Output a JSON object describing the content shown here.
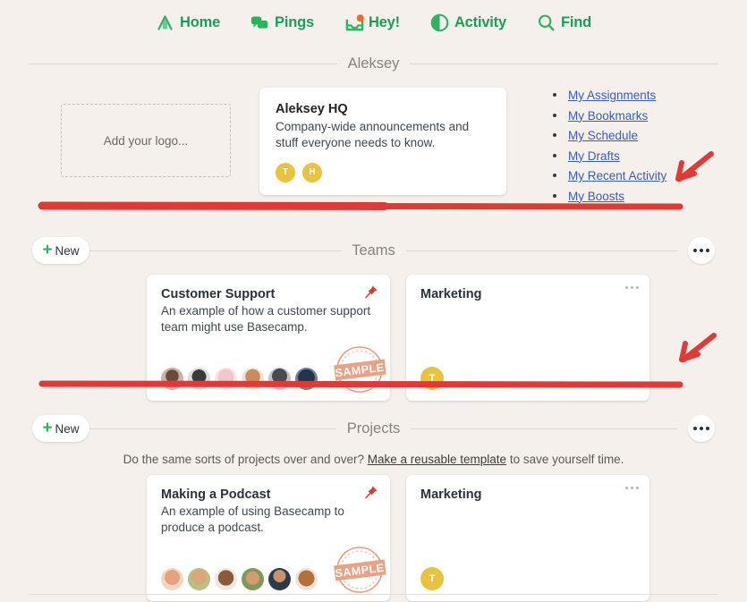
{
  "nav": {
    "items": [
      {
        "label": "Home",
        "icon": "home-icon"
      },
      {
        "label": "Pings",
        "icon": "chat-bubbles-icon"
      },
      {
        "label": "Hey!",
        "icon": "inbox-tray-icon",
        "badge": true
      },
      {
        "label": "Activity",
        "icon": "pie-clock-icon"
      },
      {
        "label": "Find",
        "icon": "search-icon"
      }
    ],
    "accent_color": "#1a9e57",
    "badge_color": "#f56a20"
  },
  "account": {
    "section_title": "Aleksey",
    "logo_placeholder": "Add your logo...",
    "hq": {
      "title": "Aleksey HQ",
      "description": "Company-wide announcements and stuff everyone needs to know.",
      "avatars": [
        {
          "initial": "T",
          "color": "#e8c33f"
        },
        {
          "initial": "H",
          "color": "#e2b93a"
        }
      ]
    },
    "my_links": [
      "My Assignments",
      "My Bookmarks",
      "My Schedule",
      "My Drafts",
      "My Recent Activity",
      "My Boosts"
    ]
  },
  "teams": {
    "section_title": "Teams",
    "new_label": "New",
    "menu_icon": "ellipsis-icon",
    "cards": [
      {
        "title": "Customer Support",
        "description": "An example of how a customer support team might use Basecamp.",
        "pinned": true,
        "stamp": "SAMPLE",
        "avatar_count": 6
      },
      {
        "title": "Marketing",
        "description": "",
        "pinned": false,
        "menu_icon": "ellipsis-icon",
        "avatars": [
          {
            "initial": "T",
            "color": "#e8c33f"
          }
        ]
      }
    ]
  },
  "projects": {
    "section_title": "Projects",
    "new_label": "New",
    "menu_icon": "ellipsis-icon",
    "template_prompt_before": "Do the same sorts of projects over and over? ",
    "template_link": "Make a reusable template",
    "template_prompt_after": " to save yourself time.",
    "cards": [
      {
        "title": "Making a Podcast",
        "description": "An example of using Basecamp to produce a podcast.",
        "pinned": true,
        "stamp": "SAMPLE",
        "avatar_count": 6
      },
      {
        "title": "Marketing",
        "description": "",
        "pinned": false,
        "menu_icon": "ellipsis-icon",
        "avatars": [
          {
            "initial": "T",
            "color": "#e8c33f"
          }
        ]
      }
    ]
  },
  "annotations": {
    "marker_color": "#e03a36",
    "items": [
      {
        "type": "arrow",
        "name": "arrow-to-my-boosts"
      },
      {
        "type": "underline",
        "name": "underline-under-hq-row"
      },
      {
        "type": "arrow",
        "name": "arrow-to-teams-row"
      },
      {
        "type": "underline",
        "name": "underline-under-teams-row"
      }
    ]
  },
  "stamp_text": "SAMPLE"
}
